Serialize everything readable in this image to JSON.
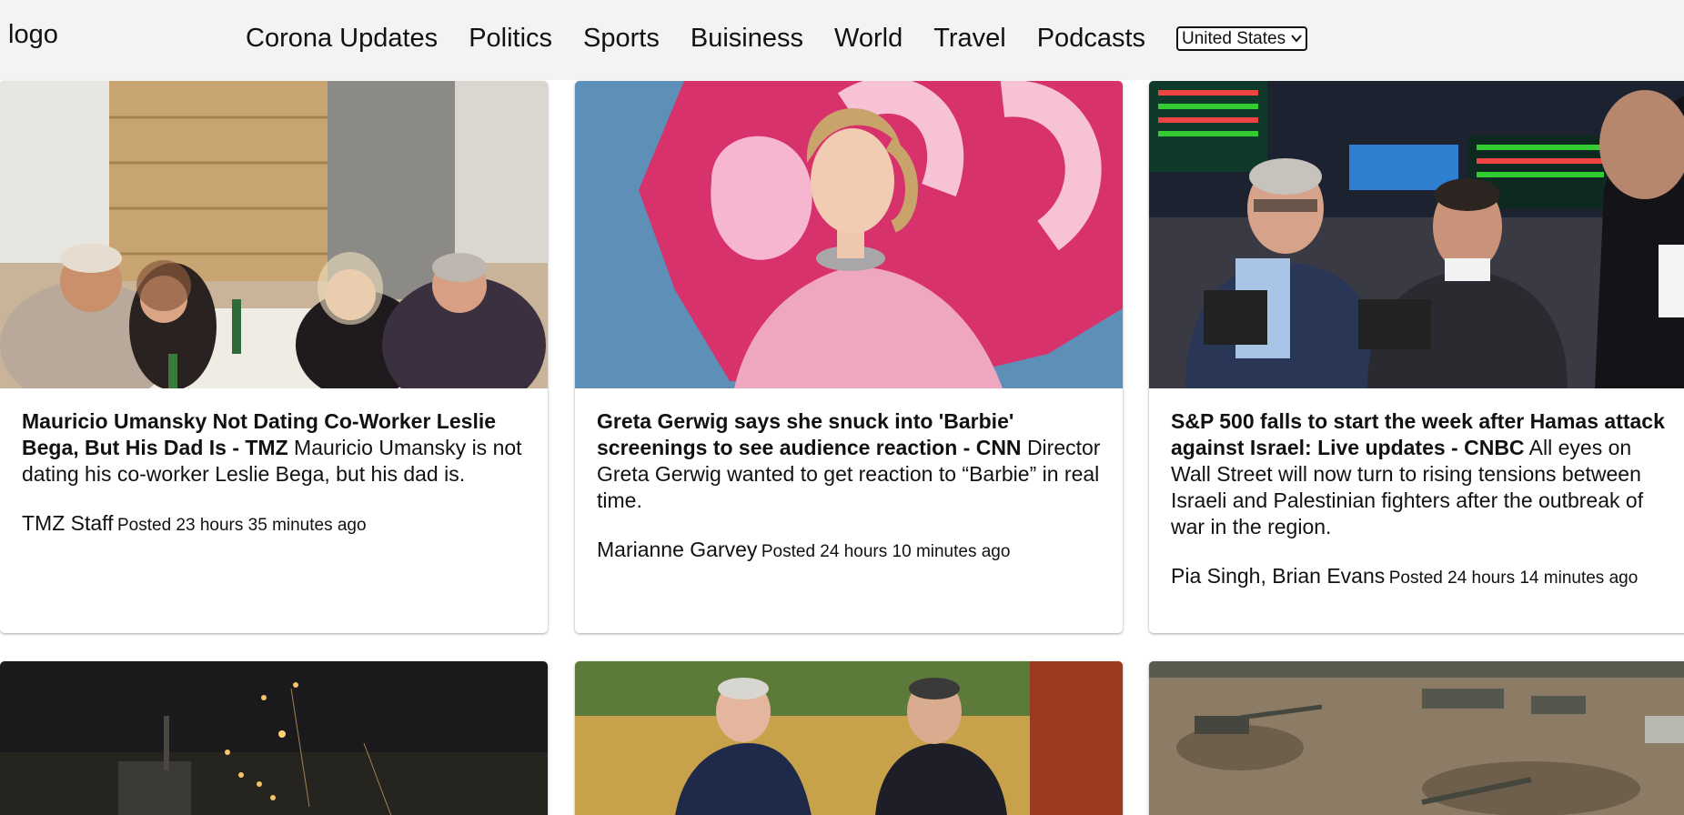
{
  "header": {
    "logo": "logo",
    "nav": [
      "Corona Updates",
      "Politics",
      "Sports",
      "Buisiness",
      "World",
      "Travel",
      "Podcasts"
    ],
    "country_select": {
      "selected": "United States",
      "icon": "chevron-down-icon"
    }
  },
  "articles": [
    {
      "title": "Mauricio Umansky Not Dating Co-Worker Leslie Bega, But His Dad Is - TMZ",
      "description": "Mauricio Umansky is not dating his co-worker Leslie Bega, but his dad is.",
      "author": "TMZ Staff",
      "posted": "Posted 23 hours 35 minutes ago"
    },
    {
      "title": "Greta Gerwig says she snuck into 'Barbie' screenings to see audience reaction - CNN",
      "description": "Director Greta Gerwig wanted to get reaction to “Barbie” in real time.",
      "author": "Marianne Garvey",
      "posted": "Posted 24 hours 10 minutes ago"
    },
    {
      "title": "S&P 500 falls to start the week after Hamas attack against Israel: Live updates - CNBC",
      "description": "All eyes on Wall Street will now turn to rising tensions between Israeli and Palestinian fighters after the outbreak of war in the region.",
      "author": "Pia Singh, Brian Evans",
      "posted": "Posted 24 hours 14 minutes ago"
    }
  ],
  "colors": {
    "header_bg": "#f3f3f3",
    "text": "#111111",
    "card_bg": "#ffffff"
  }
}
